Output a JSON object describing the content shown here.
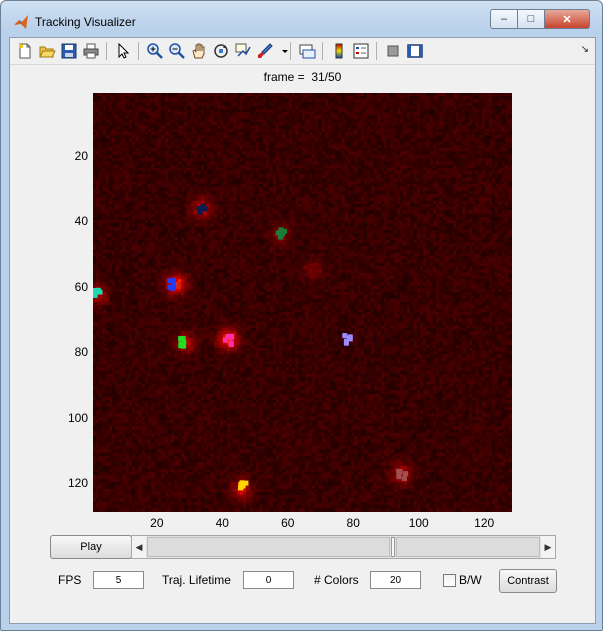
{
  "window": {
    "title": "Tracking Visualizer",
    "minimize": "–",
    "maximize": "□",
    "close": "✕"
  },
  "toolbar": {
    "icons": [
      "new-figure-icon",
      "open-file-icon",
      "save-icon",
      "print-icon",
      "edit-plot-arrow-icon",
      "zoom-in-icon",
      "zoom-out-icon",
      "pan-hand-icon",
      "rotate-3d-icon",
      "data-cursor-icon",
      "brush-icon",
      "link-plot-icon",
      "insert-colorbar-icon",
      "insert-legend-icon",
      "hide-plot-tools-icon",
      "show-plot-tools-icon",
      "dock-arrow-icon"
    ]
  },
  "plot": {
    "frame_label": "frame =  31/50",
    "y_ticks": [
      "20",
      "40",
      "60",
      "80",
      "100",
      "120"
    ],
    "x_ticks": [
      "20",
      "40",
      "60",
      "80",
      "100",
      "120"
    ],
    "x_range": [
      0.5,
      128.5
    ],
    "y_range": [
      0.5,
      128.5
    ],
    "tick_values": [
      20,
      40,
      60,
      80,
      100,
      120
    ],
    "colormap": "black-red (hot-like)",
    "background_color": "#1a0000",
    "spots": [
      {
        "x": 26,
        "y": 59,
        "intensity": 1.0
      },
      {
        "x": 34,
        "y": 36,
        "intensity": 0.6
      },
      {
        "x": 42,
        "y": 76,
        "intensity": 0.85
      },
      {
        "x": 29,
        "y": 77,
        "intensity": 0.55
      },
      {
        "x": 46,
        "y": 122,
        "intensity": 0.6
      },
      {
        "x": 95,
        "y": 117,
        "intensity": 0.55
      },
      {
        "x": 58,
        "y": 44,
        "intensity": 0.35
      },
      {
        "x": 68,
        "y": 55,
        "intensity": 0.3
      },
      {
        "x": 2,
        "y": 62,
        "intensity": 0.5
      }
    ],
    "tracks": [
      {
        "x": 34,
        "y": 36,
        "color": "#0a1a4a"
      },
      {
        "x": 58,
        "y": 43,
        "color": "#1f7a3a"
      },
      {
        "x": 25,
        "y": 59,
        "color": "#1f3cff"
      },
      {
        "x": 1.5,
        "y": 61,
        "color": "#20d8b0"
      },
      {
        "x": 28,
        "y": 77,
        "color": "#22dd22"
      },
      {
        "x": 42,
        "y": 76,
        "color": "#ff2fa0"
      },
      {
        "x": 78,
        "y": 76,
        "color": "#9a8cff"
      },
      {
        "x": 46,
        "y": 121,
        "color": "#ffd400"
      },
      {
        "x": 95,
        "y": 117,
        "color": "#a05050"
      }
    ]
  },
  "controls": {
    "play_label": "Play",
    "slider_value": 31,
    "slider_max": 50,
    "fps_label": "FPS",
    "fps_value": "5",
    "traj_label": "Traj. Lifetime",
    "traj_value": "0",
    "colors_label": "# Colors",
    "colors_value": "20",
    "bw_label": "B/W",
    "contrast_label": "Contrast"
  }
}
